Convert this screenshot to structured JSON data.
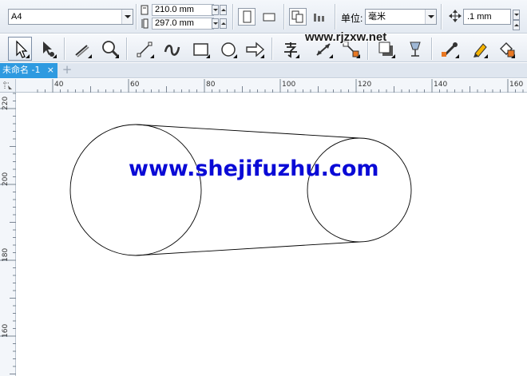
{
  "property_bar": {
    "page_size": "A4",
    "width_value": "210.0 mm",
    "height_value": "297.0 mm",
    "units_label": "单位:",
    "units_value": "毫米",
    "nudge_value": ".1 mm"
  },
  "document": {
    "tab_title": "未命名 -1",
    "tab_close": "×",
    "add_tab": "+"
  },
  "rulers": {
    "horizontal": [
      "40",
      "60",
      "80",
      "100",
      "120",
      "140",
      "160"
    ],
    "vertical": [
      "220",
      "200",
      "180",
      "160"
    ]
  },
  "watermarks": {
    "top": "www.rjzxw.net",
    "canvas": "www.shejifuzhu.com"
  },
  "colors": {
    "tab_active": "#2e9ae0",
    "watermark_canvas": "#0a0ad6"
  }
}
